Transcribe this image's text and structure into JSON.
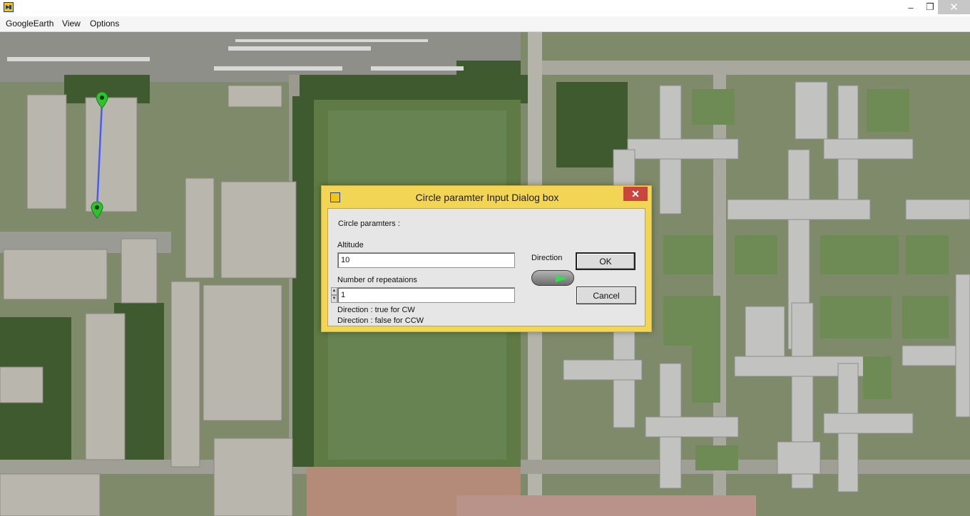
{
  "menu": {
    "items": [
      "GoogleEarth",
      "View",
      "Options"
    ]
  },
  "window_controls": {
    "minimize": "–",
    "maximize": "❐",
    "close": "✕"
  },
  "dialog": {
    "title": "Circle paramter Input Dialog box",
    "close": "✕",
    "section_label": "Circle paramters :",
    "altitude_label": "Altitude",
    "altitude_value": "10",
    "repeat_label": "Number of repeataions",
    "repeat_value": "1",
    "direction_label": "Direction",
    "direction_value": true,
    "ok_label": "OK",
    "cancel_label": "Cancel",
    "hint_cw": "Direction : true for CW",
    "hint_ccw": "Direction : false for CCW"
  },
  "colors": {
    "dialog_frame": "#f2d554",
    "path_line": "#4a5cf0",
    "marker": "#2fc12f",
    "toggle_led": "#2ee04a"
  }
}
